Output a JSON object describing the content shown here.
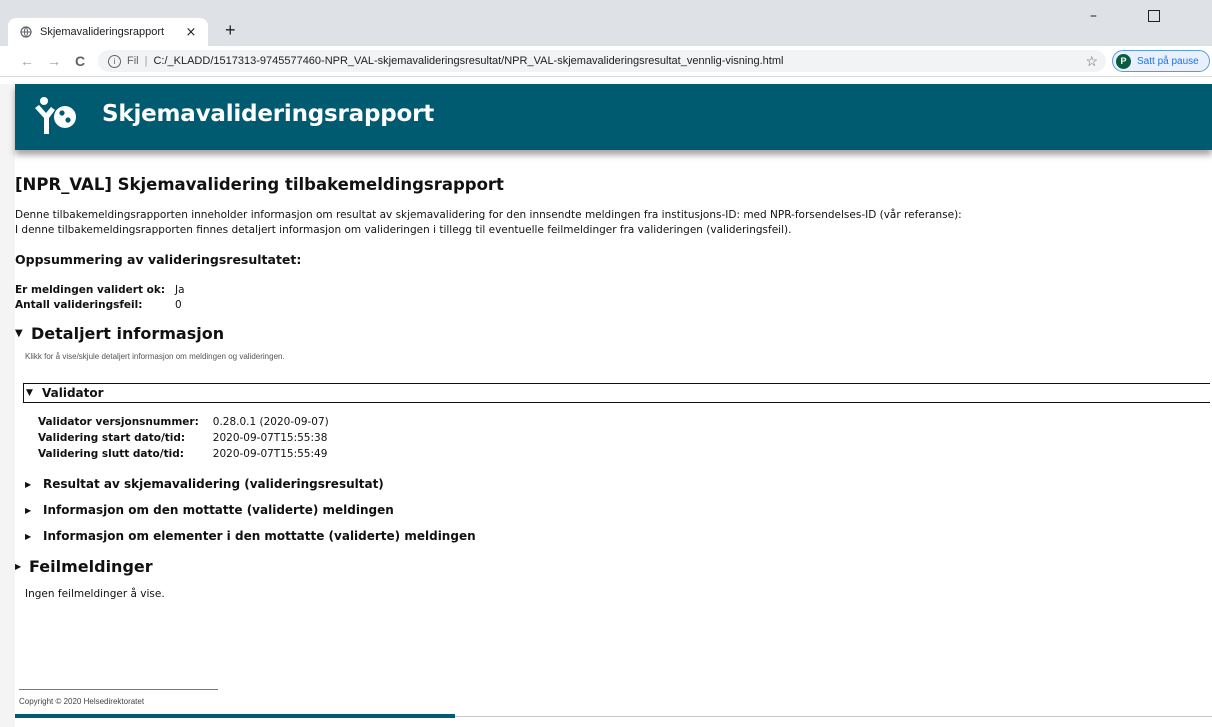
{
  "browser": {
    "tab_title": "Skjemavalideringsrapport",
    "tab_close": "×",
    "new_tab": "+",
    "minimize": "–",
    "omnibox_scheme": "Fil",
    "omnibox_separator": "|",
    "url": "C:/_KLADD/1517313-9745577460-NPR_VAL-skjemavalideringsresultat/NPR_VAL-skjemavalideringsresultat_vennlig-visning.html",
    "profile_initial": "P",
    "profile_label": "Satt på pause"
  },
  "banner": {
    "title": "Skjemavalideringsrapport",
    "color": "#005b71"
  },
  "report": {
    "title": "[NPR_VAL] Skjemavalidering tilbakemeldingsrapport",
    "intro_line1": "Denne tilbakemeldingsrapporten inneholder informasjon om resultat av skjemavalidering for den innsendte meldingen fra institusjons-ID: med NPR-forsendelses-ID (vår referanse):",
    "intro_line2": "I denne tilbakemeldingsrapporten finnes detaljert informasjon om valideringen i tillegg til eventuelle feilmeldinger fra valideringen (valideringsfeil).",
    "summary_heading": "Oppsummering av valideringsresultatet:",
    "summary": [
      {
        "label": "Er meldingen validert ok:",
        "value": "Ja"
      },
      {
        "label": "Antall valideringsfeil:",
        "value": "0"
      }
    ]
  },
  "details": {
    "heading": "Detaljert informasjon",
    "hint": "Klikk for å vise/skjule detaljert informasjon om meldingen og valideringen.",
    "validator": {
      "heading": "Validator",
      "rows": [
        {
          "label": "Validator versjonsnummer:",
          "value": "0.28.0.1 (2020-09-07)"
        },
        {
          "label": "Validering start dato/tid:",
          "value": "2020-09-07T15:55:38"
        },
        {
          "label": "Validering slutt dato/tid:",
          "value": "2020-09-07T15:55:49"
        }
      ]
    },
    "subsections": [
      "Resultat av skjemavalidering (valideringsresultat)",
      "Informasjon om den mottatte (validerte) meldingen",
      "Informasjon om elementer i den mottatte (validerte) meldingen"
    ]
  },
  "errors": {
    "heading": "Feilmeldinger",
    "message": "Ingen feilmeldinger å vise."
  },
  "footer": {
    "copyright": "Copyright © 2020 Helsedirektoratet"
  }
}
